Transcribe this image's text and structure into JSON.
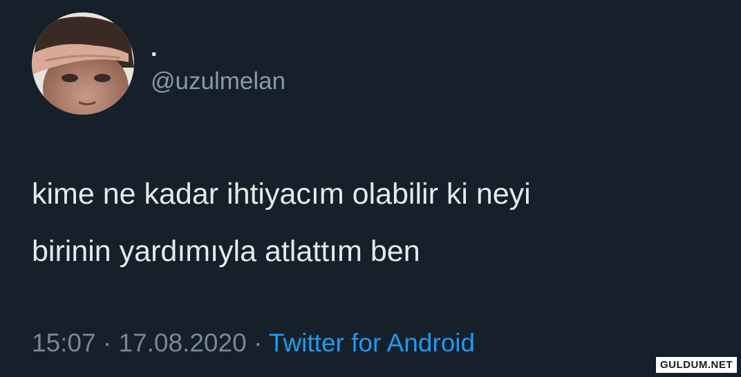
{
  "user": {
    "display_name": ".",
    "handle": "@uzulmelan"
  },
  "tweet": {
    "lines": [
      "kime ne kadar ihtiyacım olabilir ki neyi",
      "birinin yardımıyla atlattım ben"
    ],
    "time": "15:07",
    "separator": "·",
    "date": "17.08.2020",
    "source": "Twitter for Android"
  },
  "watermark": "GULDUM.NET"
}
